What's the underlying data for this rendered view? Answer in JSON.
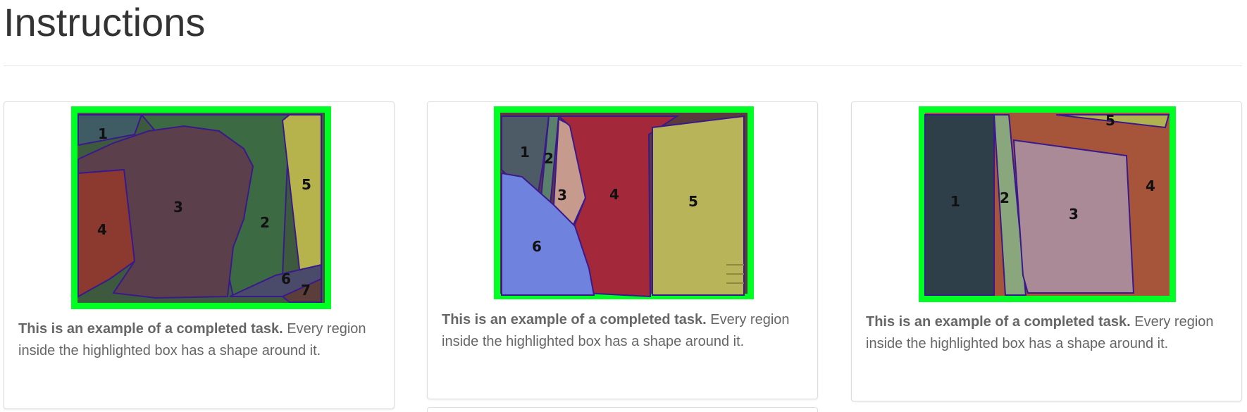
{
  "page": {
    "title": "Instructions"
  },
  "cards": [
    {
      "caption_bold": "This is an example of a completed task.",
      "caption_rest": " Every region inside the highlighted box has a shape around it.",
      "region_labels": [
        "1",
        "2",
        "3",
        "4",
        "5",
        "6",
        "7"
      ]
    },
    {
      "caption_bold": "This is an example of a completed task.",
      "caption_rest": " Every region inside the highlighted box has a shape around it.",
      "region_labels": [
        "1",
        "2",
        "3",
        "4",
        "5",
        "6"
      ]
    },
    {
      "caption_bold": "This is an example of a completed task.",
      "caption_rest": " Every region inside the highlighted box has a shape around it.",
      "region_labels": [
        "1",
        "2",
        "3",
        "4",
        "5"
      ]
    }
  ],
  "colors": {
    "highlight_box": "#00ff22",
    "region_outline": "#3a1a8a"
  }
}
